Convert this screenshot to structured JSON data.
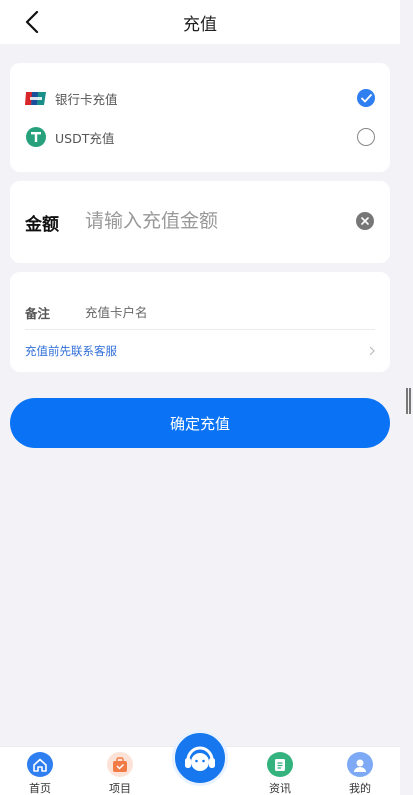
{
  "header": {
    "title": "充值",
    "back_icon": "chevron-left-icon"
  },
  "methods": [
    {
      "label": "银行卡充值",
      "icon": "unionpay-icon",
      "selected": true
    },
    {
      "label": "USDT充值",
      "icon": "tether-icon",
      "selected": false
    }
  ],
  "amount": {
    "label": "金额",
    "placeholder": "请输入充值金额",
    "value": ""
  },
  "note": {
    "label": "备注",
    "placeholder": "充值卡户名",
    "value": ""
  },
  "contact": {
    "label": "充值前先联系客服"
  },
  "confirm": {
    "label": "确定充值"
  },
  "tabs": [
    {
      "label": "首页",
      "icon": "home-icon",
      "color": "#2f7ff0"
    },
    {
      "label": "项目",
      "icon": "bag-icon",
      "color": "#f07b45"
    },
    {
      "label": "",
      "icon": "customer-service-icon",
      "color": "#1677ee"
    },
    {
      "label": "资讯",
      "icon": "news-icon",
      "color": "#35b37e"
    },
    {
      "label": "我的",
      "icon": "user-icon",
      "color": "#7ea9f5"
    }
  ],
  "colors": {
    "accent": "#0a73f5",
    "link": "#2f6ed8",
    "background": "#f3f2f7"
  }
}
